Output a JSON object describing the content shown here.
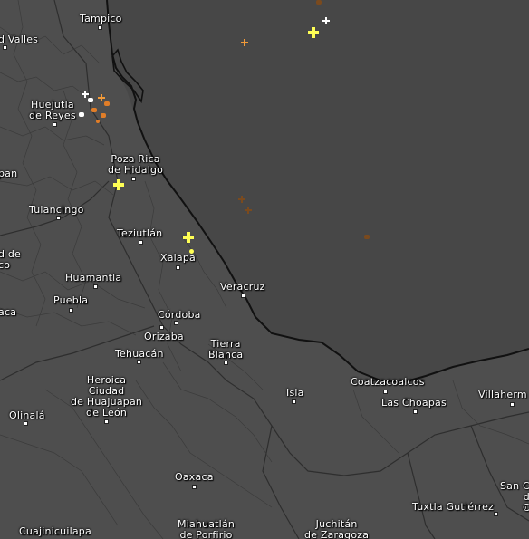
{
  "map": {
    "background": "#4a4a4a",
    "land_color": "#4e4e4e",
    "sea_color": "#474747",
    "coast_color": "#111111",
    "border_color": "#2e2e2e",
    "cities": [
      {
        "id": "tampico",
        "text": "Tampico"
      },
      {
        "id": "valles",
        "text": "d Valles"
      },
      {
        "id": "huejutla",
        "text": "Huejutla\nde Reyes"
      },
      {
        "id": "pozarica",
        "text": "Poza Rica\nde Hidalgo"
      },
      {
        "id": "pan",
        "text": "pan"
      },
      {
        "id": "tulancingo",
        "text": "Tulancingo"
      },
      {
        "id": "teziutlan",
        "text": "Teziutlán"
      },
      {
        "id": "xalapa",
        "text": "Xalapa"
      },
      {
        "id": "dde",
        "text": "d de\nco"
      },
      {
        "id": "huamantla",
        "text": "Huamantla"
      },
      {
        "id": "puebla",
        "text": "Puebla"
      },
      {
        "id": "aca",
        "text": "aca"
      },
      {
        "id": "veracruz",
        "text": "Veracruz"
      },
      {
        "id": "cordoba",
        "text": "Córdoba"
      },
      {
        "id": "orizaba",
        "text": "Orizaba"
      },
      {
        "id": "tehuacan",
        "text": "Tehuacán"
      },
      {
        "id": "tierrablanca",
        "text": "Tierra\nBlanca"
      },
      {
        "id": "huajuapan",
        "text": "Heroica\nCiudad\nde Huajuapan\nde León"
      },
      {
        "id": "olinala",
        "text": "Olinalá"
      },
      {
        "id": "isla",
        "text": "Isla"
      },
      {
        "id": "coatzacoalcos",
        "text": "Coatzacoalcos"
      },
      {
        "id": "laschoapas",
        "text": "Las Choapas"
      },
      {
        "id": "villaherm",
        "text": "Villaherm"
      },
      {
        "id": "oaxaca",
        "text": "Oaxaca"
      },
      {
        "id": "sanc",
        "text": "San C\nd\nC"
      },
      {
        "id": "tuxtla",
        "text": "Tuxtla Gutiérrez"
      },
      {
        "id": "cuajinicuilapa",
        "text": "Cuajinicuilapa"
      },
      {
        "id": "miahuatlan",
        "text": "Miahuatlán\nde Porfirio"
      },
      {
        "id": "juchitan",
        "text": "Juchitán\nde Zaragoza"
      }
    ],
    "lightning": [
      {
        "color": "#ffff55",
        "size": "large"
      },
      {
        "color": "#ffff55",
        "size": "large"
      },
      {
        "color": "#ffff55",
        "size": "large"
      },
      {
        "color": "#ffffff",
        "size": "small"
      },
      {
        "color": "#ffffff",
        "size": "small"
      },
      {
        "color": "#f29a38",
        "size": "small"
      },
      {
        "color": "#f29a38",
        "size": "small"
      },
      {
        "color": "#e07d28",
        "size": "small"
      },
      {
        "color": "#7a4a1e",
        "size": "small"
      },
      {
        "color": "#7a4a1e",
        "size": "small"
      },
      {
        "color": "#7a4a1e",
        "size": "small"
      }
    ]
  }
}
